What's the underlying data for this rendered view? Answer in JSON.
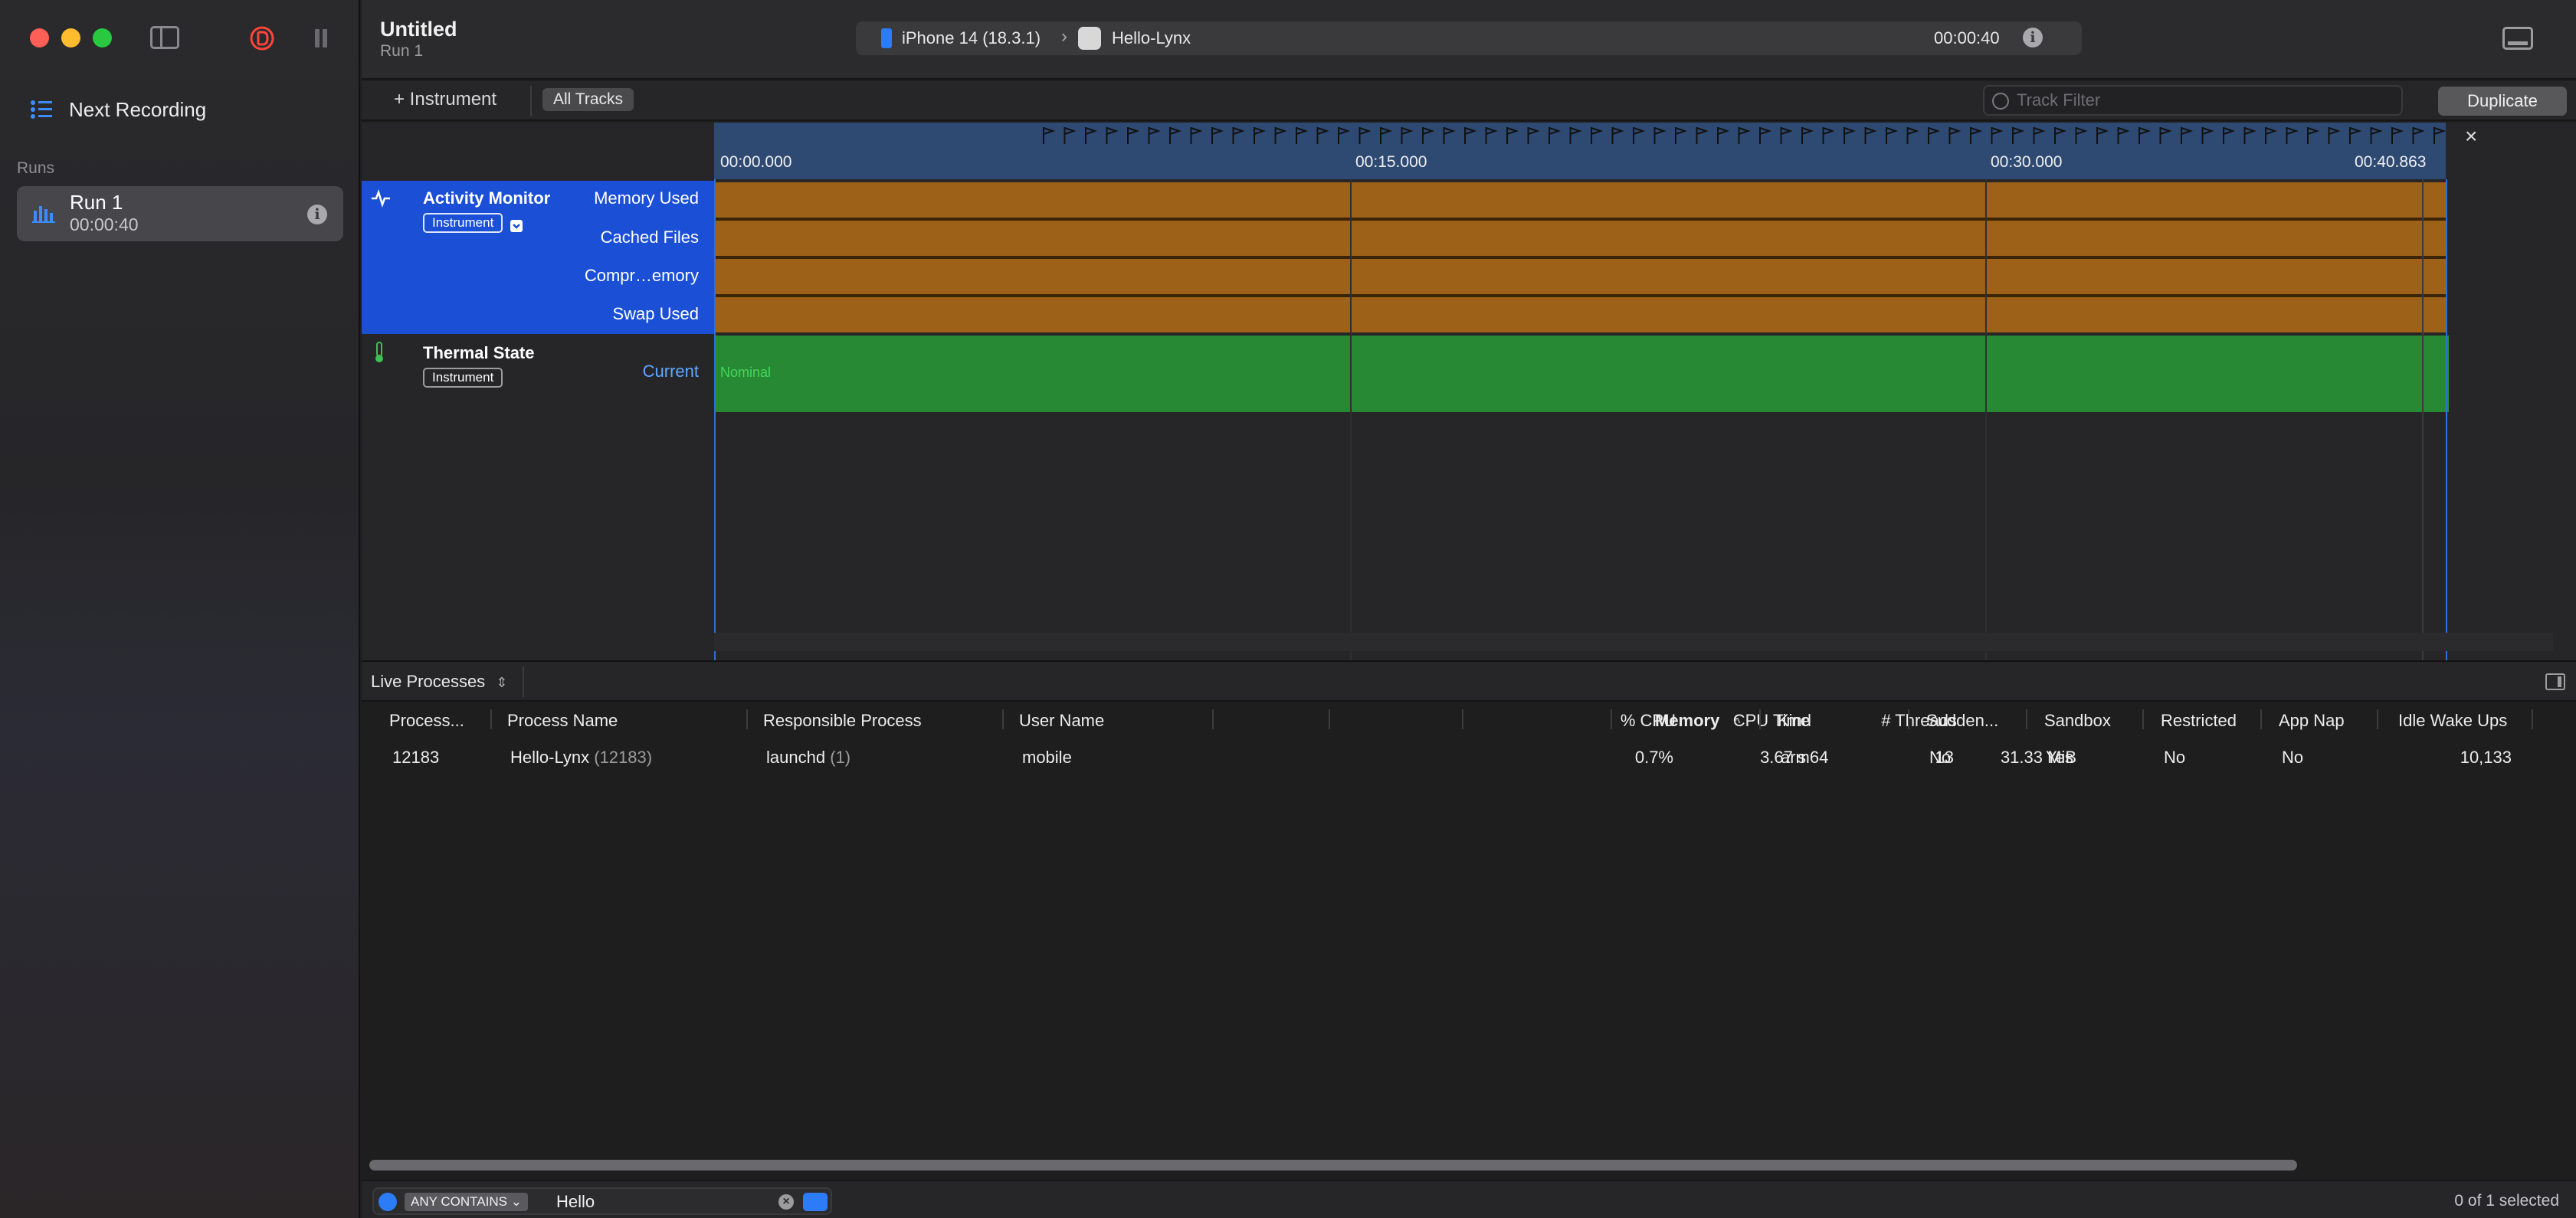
{
  "sidebar": {
    "next_recording": "Next Recording",
    "runs_label": "Runs",
    "run": {
      "title": "Run 1",
      "time": "00:00:40"
    }
  },
  "titlebar": {
    "title": "Untitled",
    "subtitle": "Run 1",
    "device": "iPhone 14 (18.3.1)",
    "app": "Hello-Lynx",
    "elapsed": "00:00:40"
  },
  "toolbar": {
    "add_instrument": "+ Instrument",
    "all_tracks": "All Tracks",
    "track_filter_placeholder": "Track Filter",
    "duplicate": "Duplicate"
  },
  "timeline": {
    "ticks": [
      "00:00.000",
      "00:15.000",
      "00:30.000",
      "00:40.863"
    ],
    "tracks": {
      "activity": {
        "name": "Activity Monitor",
        "badge": "Instrument",
        "lanes": [
          "Memory Used",
          "Cached Files",
          "Compr…emory",
          "Swap Used"
        ]
      },
      "thermal": {
        "name": "Thermal State",
        "badge": "Instrument",
        "lane": "Current",
        "value": "Nominal"
      }
    },
    "colors": {
      "activity_lane": "#9e6118",
      "thermal_lane": "#278934",
      "selection": "#1a4fd6"
    }
  },
  "detail": {
    "view_selector": "Live Processes",
    "columns": [
      "Process...",
      "Process Name",
      "Responsible Process",
      "User Name",
      "% CPU",
      "CPU Time",
      "# Threads",
      "Memory",
      "Kind",
      "Sudden...",
      "Sandbox",
      "Restricted",
      "App Nap",
      "Idle Wake Ups"
    ],
    "rows": [
      {
        "pid": "12183",
        "name": "Hello-Lynx",
        "name_pid": "(12183)",
        "responsible": "launchd",
        "responsible_pid": "(1)",
        "user": "mobile",
        "cpu": "0.7%",
        "cpu_time": "3.67 s",
        "threads": "13",
        "memory": "31.33 MiB",
        "kind": "arm64",
        "sudden": "No",
        "sandbox": "Yes",
        "restricted": "No",
        "app_nap": "No",
        "idle_wake_ups": "10,133"
      }
    ],
    "filter": {
      "scope": "ANY CONTAINS",
      "text": "Hello"
    },
    "selection_count": "0 of 1 selected"
  }
}
